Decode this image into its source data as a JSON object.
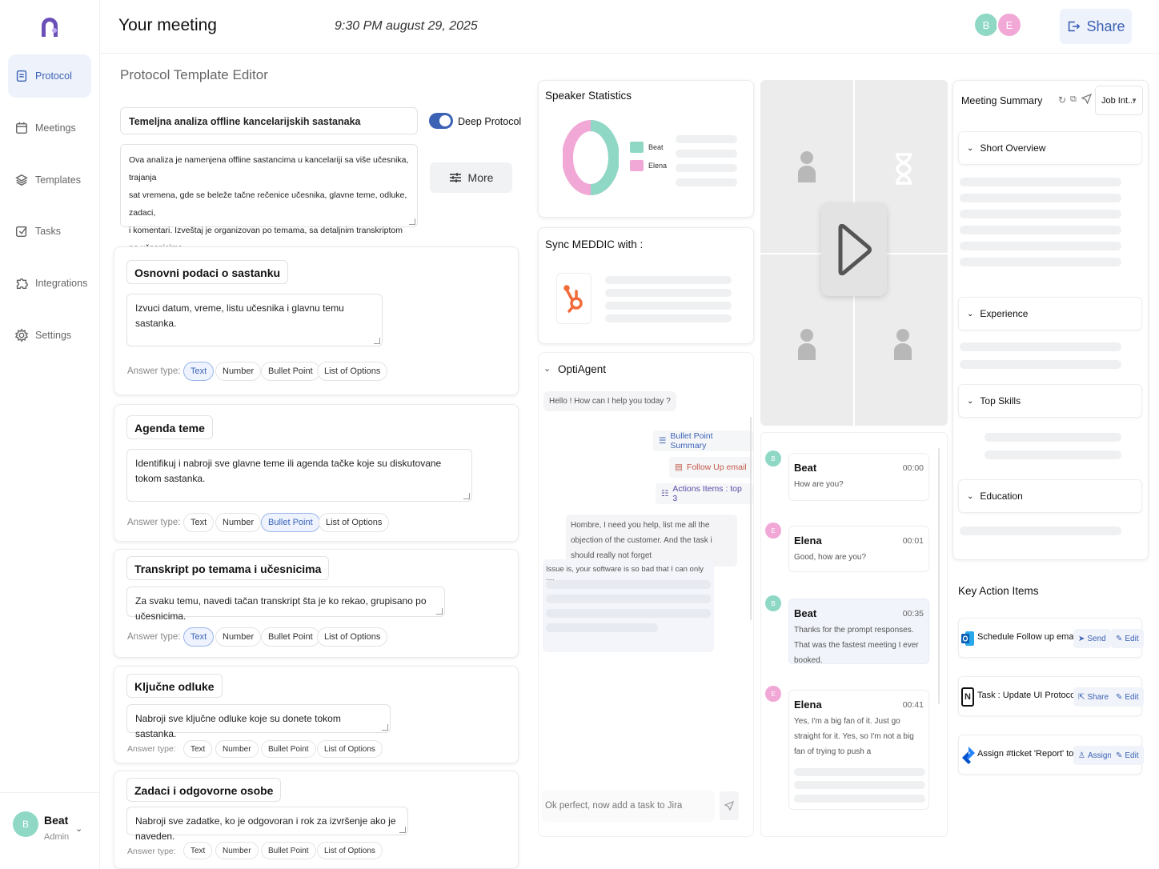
{
  "sidebar": {
    "items": [
      {
        "label": "Protocol",
        "icon": "document-icon"
      },
      {
        "label": "Meetings",
        "icon": "calendar-icon"
      },
      {
        "label": "Templates",
        "icon": "layers-icon"
      },
      {
        "label": "Tasks",
        "icon": "checkbox-icon"
      },
      {
        "label": "Integrations",
        "icon": "puzzle-icon"
      },
      {
        "label": "Settings",
        "icon": "gear-icon"
      }
    ],
    "user": {
      "initial": "B",
      "name": "Beat",
      "role": "Admin"
    }
  },
  "header": {
    "title": "Your meeting",
    "datetime": "9:30 PM august 29, 2025",
    "participants": [
      "B",
      "E"
    ],
    "share_label": "Share"
  },
  "editor": {
    "title": "Protocol Template Editor",
    "template_name": "Temeljna analiza offline kancelarijskih sastanaka",
    "deep_protocol_label": "Deep Protocol",
    "more_label": "More",
    "description_lines": [
      "Ova analiza je namenjena offline sastancima u kancelariji sa više učesnika, trajanja",
      "sat vremena, gde se beleže tačne rečenice učesnika, glavne teme, odluke, zadaci,",
      "i komentari. Izveštaj je organizovan po temama, sa detaljnim transkriptom po učesnicima."
    ],
    "answer_type_label": "Answer type:",
    "answer_types": [
      "Text",
      "Number",
      "Bullet Point",
      "List of Options"
    ],
    "sections": [
      {
        "title": "Osnovni podaci o sastanku",
        "prompt": "Izvuci datum, vreme, listu učesnika i glavnu temu sastanka.",
        "selected": "Text"
      },
      {
        "title": "Agenda teme",
        "prompt": "Identifikuj i nabroji sve glavne teme ili agenda tačke koje su diskutovane tokom sastanka.",
        "selected": "Bullet Point"
      },
      {
        "title": "Transkript po temama i učesnicima",
        "prompt": "Za svaku temu, navedi tačan transkript šta je ko rekao, grupisano po učesnicima.",
        "selected": "Text"
      },
      {
        "title": "Ključne odluke",
        "prompt": "Nabroji sve ključne odluke koje su donete tokom sastanka.",
        "selected": ""
      },
      {
        "title": "Zadaci i odgovorne osobe",
        "prompt": "Nabroji sve zadatke, ko je odgovoran i rok za izvršenje ako je naveden.",
        "selected": ""
      }
    ]
  },
  "speaker_stats": {
    "title": "Speaker Statistics",
    "legend": [
      {
        "name": "Beat",
        "color": "#8fd8c6"
      },
      {
        "name": "Elena",
        "color": "#f1a8d6"
      }
    ]
  },
  "sync": {
    "title": "Sync MEDDIC with :",
    "icon": "hubspot-icon"
  },
  "agent": {
    "title": "OptiAgent",
    "greeting": "Hello ! How can I help you today ?",
    "chips": [
      {
        "label": "Bullet Point Summary",
        "icon": "list-icon"
      },
      {
        "label": "Follow Up email",
        "icon": "mail-icon"
      },
      {
        "label": "Actions Items : top 3",
        "icon": "checklist-icon"
      }
    ],
    "user_message": "Hombre, I need you help, list me all the objection of the customer. And the task i should really not forget",
    "reply_start": "Issue is, your software is so bad that I can only ....",
    "input_placeholder": "Ok perfect, now add a task to Jira"
  },
  "transcript": [
    {
      "initial": "B",
      "name": "Beat",
      "time": "00:00",
      "text": "How are you?",
      "color": "#8fd8c6"
    },
    {
      "initial": "E",
      "name": "Elena",
      "time": "00:01",
      "text": "Good, how are you?",
      "color": "#f1a8d6"
    },
    {
      "initial": "B",
      "name": "Beat",
      "time": "00:35",
      "text": "Thanks for the prompt responses. That was the fastest meeting I ever booked.",
      "color": "#8fd8c6"
    },
    {
      "initial": "E",
      "name": "Elena",
      "time": "00:41",
      "text": "Yes, I'm a big fan of it. Just go straight for it. Yes, so I'm not a big fan of trying to push a",
      "color": "#f1a8d6"
    }
  ],
  "summary": {
    "title": "Meeting Summary",
    "dropdown": "Job Int...",
    "sections": [
      "Short Overview",
      "Experience",
      "Top Skills",
      "Education"
    ]
  },
  "actions": {
    "title": "Key Action Items",
    "items": [
      {
        "label": "Schedule Follow up email",
        "icon": "outlook-icon",
        "primary": "Send",
        "secondary": "Edit"
      },
      {
        "label": "Task : Update UI Protocol",
        "icon": "notion-icon",
        "primary": "Share",
        "secondary": "Edit"
      },
      {
        "label": "Assign #ticket 'Report' to Jim",
        "icon": "jira-icon",
        "primary": "Assign",
        "secondary": "Edit"
      }
    ]
  }
}
